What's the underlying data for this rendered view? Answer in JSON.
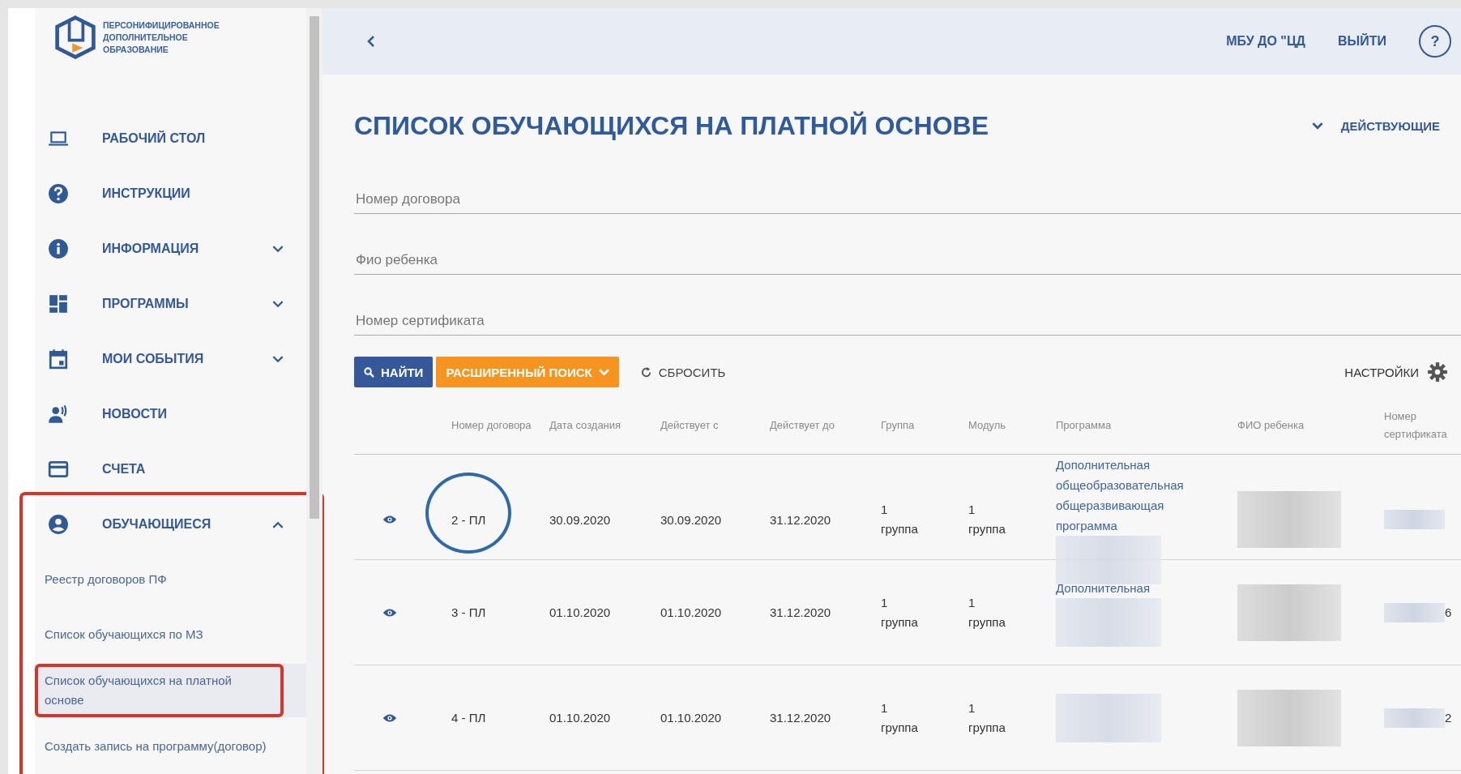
{
  "sidebar": {
    "logo_lines": [
      "ПЕРСОНИФИЦИРОВАННОЕ",
      "ДОПОЛНИТЕЛЬНОЕ",
      "ОБРАЗОВАНИЕ"
    ],
    "items": [
      {
        "label": "РАБОЧИЙ СТОЛ"
      },
      {
        "label": "ИНСТРУКЦИИ"
      },
      {
        "label": "ИНФОРМАЦИЯ",
        "expanded": false
      },
      {
        "label": "ПРОГРАММЫ",
        "expanded": false
      },
      {
        "label": "МОИ СОБЫТИЯ",
        "expanded": false
      },
      {
        "label": "НОВОСТИ",
        "highlighted": false
      },
      {
        "label": "СЧЕТА",
        "highlighted": false
      },
      {
        "label": "ОБУЧАЮЩИЕСЯ",
        "expanded": true,
        "highlighted": true,
        "children": [
          {
            "label": "Реестр договоров ПФ",
            "selected": false,
            "highlighted": false
          },
          {
            "label": "Список обучающихся по МЗ",
            "selected": false,
            "highlighted": false
          },
          {
            "label": "Список обучающихся на платной основе",
            "selected": true,
            "highlighted": true
          },
          {
            "label": "Создать запись на программу(договор)",
            "selected": false,
            "highlighted": false
          }
        ]
      }
    ]
  },
  "header": {
    "organization": "МБУ ДО \"ЦД",
    "logout": "ВЫЙТИ",
    "help": "?"
  },
  "page": {
    "title": "СПИСОК ОБУЧАЮЩИХСЯ НА ПЛАТНОЙ ОСНОВЕ",
    "filter": "ДЕЙСТВУЮЩИЕ"
  },
  "fields": [
    {
      "placeholder": "Номер договора"
    },
    {
      "placeholder": "Фио ребенка"
    },
    {
      "placeholder": "Номер сертификата"
    }
  ],
  "buttons": [
    {
      "label": "НАЙТИ",
      "kind": "primary"
    },
    {
      "label": "РАСШИРЕННЫЙ ПОИСК",
      "kind": "accent"
    },
    {
      "label": "СБРОСИТЬ",
      "kind": "flat"
    }
  ],
  "settings": "НАСТРОЙКИ",
  "table": {
    "columns": [
      "Номер договора",
      "Дата создания",
      "Действует с",
      "Действует до",
      "Группа",
      "Модуль",
      "Программа",
      "ФИО ребенка",
      "Номер сертификата"
    ],
    "rows": [
      {
        "number": "2 - ПЛ",
        "circled": true,
        "created": "30.09.2020",
        "from": "30.09.2020",
        "to": "31.12.2020",
        "group": "1 группа",
        "module": "1 группа",
        "program": "Дополнительная общеобразовательная общеразвивающая программа"
      },
      {
        "number": "3 - ПЛ",
        "circled": false,
        "created": "01.10.2020",
        "from": "01.10.2020",
        "to": "31.12.2020",
        "group": "1 группа",
        "module": "1 группа",
        "program": "Дополнительная",
        "certificate": "6"
      },
      {
        "number": "4 - ПЛ",
        "circled": false,
        "created": "01.10.2020",
        "from": "01.10.2020",
        "to": "31.12.2020",
        "group": "1 группа",
        "module": "1 группа",
        "program": "",
        "certificate": "2"
      }
    ]
  }
}
